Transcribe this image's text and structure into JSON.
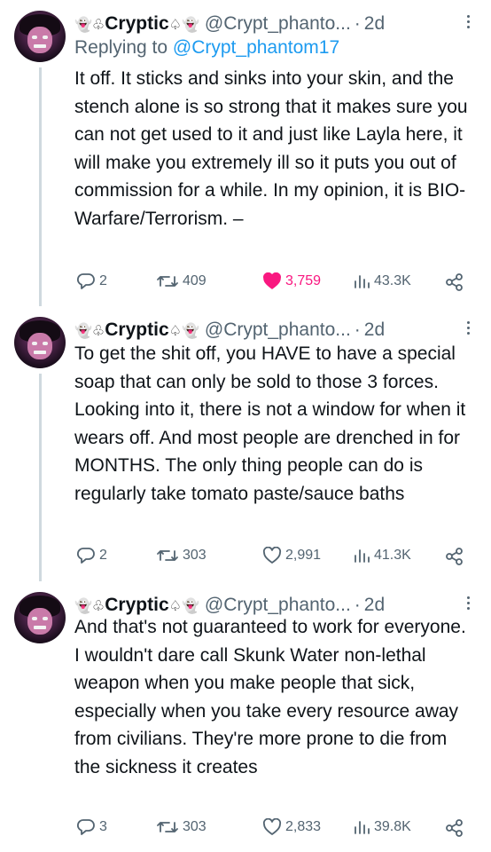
{
  "tweets": [
    {
      "author_prefix": "👻♧",
      "author_name": "Cryptic",
      "author_suffix": "♤👻",
      "handle": "@Crypt_phanto...",
      "sep": "·",
      "time": "2d",
      "reply_prefix": "Replying to ",
      "reply_to": "@Crypt_phantom17",
      "text": "It off. It sticks and sinks into your skin, and the stench alone is so strong that it makes sure you can not get used to it and just like Layla here, it will make you extremely ill so it puts you out of commission for a while. In my opinion, it is BIO-Warfare/Terrorism. –",
      "replies": "2",
      "retweets": "409",
      "likes": "3,759",
      "liked": true,
      "views": "43.3K"
    },
    {
      "author_prefix": "👻♧",
      "author_name": "Cryptic",
      "author_suffix": "♤👻",
      "handle": "@Crypt_phanto...",
      "sep": "·",
      "time": "2d",
      "text": "To get the shit off, you HAVE to have a special soap that can only be sold to those 3 forces. Looking into it, there is not a window for when it wears off. And most people are drenched in for MONTHS. The only thing people can do is regularly take tomato paste/sauce baths",
      "replies": "2",
      "retweets": "303",
      "likes": "2,991",
      "liked": false,
      "views": "41.3K"
    },
    {
      "author_prefix": "👻♧",
      "author_name": "Cryptic",
      "author_suffix": "♤👻",
      "handle": "@Crypt_phanto...",
      "sep": "·",
      "time": "2d",
      "text": "And that's not guaranteed to work for everyone. I wouldn't dare call Skunk Water non-lethal weapon when you make people that sick, especially when you take every resource away from civilians. They're more prone to die from the sickness it creates",
      "replies": "3",
      "retweets": "303",
      "likes": "2,833",
      "liked": false,
      "views": "39.8K"
    }
  ],
  "colors": {
    "text": "#0f1419",
    "secondary": "#536471",
    "link": "#1d9bf0",
    "like": "#f91880",
    "thread_line": "#cfd9de"
  },
  "icons": [
    "reply-icon",
    "retweet-icon",
    "like-icon",
    "views-icon",
    "share-icon",
    "more-icon"
  ]
}
